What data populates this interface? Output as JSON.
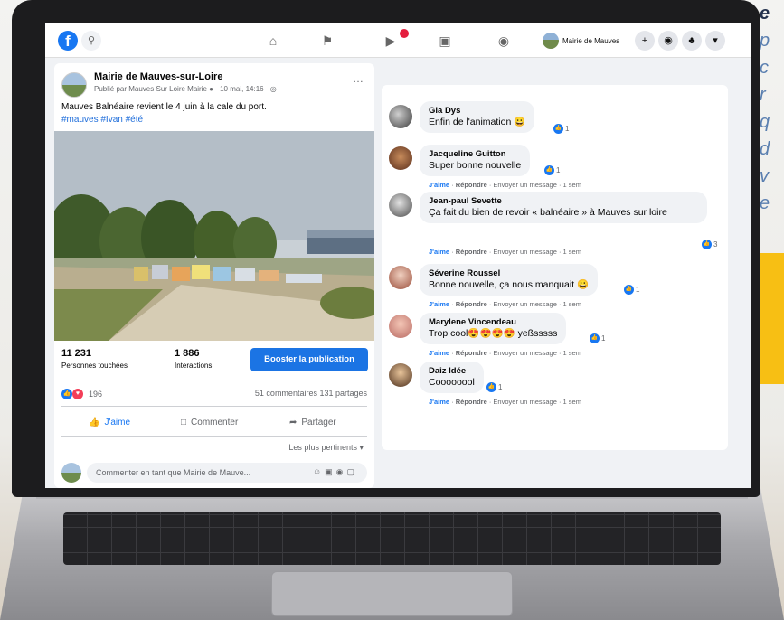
{
  "background": {
    "side_text": [
      "e",
      "p",
      "c",
      "r",
      "q",
      "d",
      "v",
      "e"
    ]
  },
  "topbar": {
    "logo": "f",
    "page_name": "Mairie de Mauves",
    "nav_icons": [
      "home-icon",
      "flag-icon",
      "video-icon",
      "marketplace-icon",
      "groups-icon"
    ]
  },
  "post": {
    "author": "Mairie de Mauves-sur-Loire",
    "meta": "Publié par Mauves Sur Loire Mairie ● · 10 mai, 14:16 · ◎",
    "text": "Mauves Balnéaire revient le 4 juin à la cale du port.",
    "tags": "#mauves #Ivan #été",
    "stats": {
      "reach_value": "11 231",
      "reach_label": "Personnes touchées",
      "interactions_value": "1 886",
      "interactions_label": "Interactions"
    },
    "boost_label": "Booster la publication",
    "reactions_count": "196",
    "comments_shares": "51 commentaires  131 partages",
    "actions": {
      "like": "J'aime",
      "comment": "Commenter",
      "share": "Partager"
    },
    "sort_label": "Les plus pertinents ▾",
    "composer_placeholder": "Commenter en tant que Mairie de Mauve..."
  },
  "comments": [
    {
      "name": "Gla Dys",
      "text": "Enfin de l'animation 😀",
      "reactions": "1",
      "actions": null
    },
    {
      "name": "Jacqueline Guitton",
      "text": "Super bonne nouvelle",
      "reactions": "1",
      "actions": {
        "like": "J'aime",
        "reply": "Répondre",
        "rest": "· Envoyer un message · 1 sem"
      }
    },
    {
      "name": "Jean-paul Sevette",
      "text": "Ça fait du bien de revoir « balnéaire » à Mauves sur loire",
      "reactions": "3",
      "actions": {
        "like": "J'aime",
        "reply": "Répondre",
        "rest": "· Envoyer un message · 1 sem"
      }
    },
    {
      "name": "Séverine Roussel",
      "text": "Bonne nouvelle, ça nous manquait 😀",
      "reactions": "1",
      "actions": {
        "like": "J'aime",
        "reply": "Répondre",
        "rest": "· Envoyer un message · 1 sem"
      }
    },
    {
      "name": "Marylene Vincendeau",
      "text": "Trop cool😍😍😍😍 yeßsssss",
      "reactions": "1",
      "actions": {
        "like": "J'aime",
        "reply": "Répondre",
        "rest": "· Envoyer un message · 1 sem"
      }
    },
    {
      "name": "Daiz Idée",
      "text": "Coooooool",
      "reactions": "1",
      "actions": {
        "like": "J'aime",
        "reply": "Répondre",
        "rest": "· Envoyer un message · 1 sem"
      }
    }
  ],
  "colors": {
    "facebook_blue": "#1877f2",
    "boost_button": "#1b74e4",
    "accent_yellow": "#f2b400"
  }
}
